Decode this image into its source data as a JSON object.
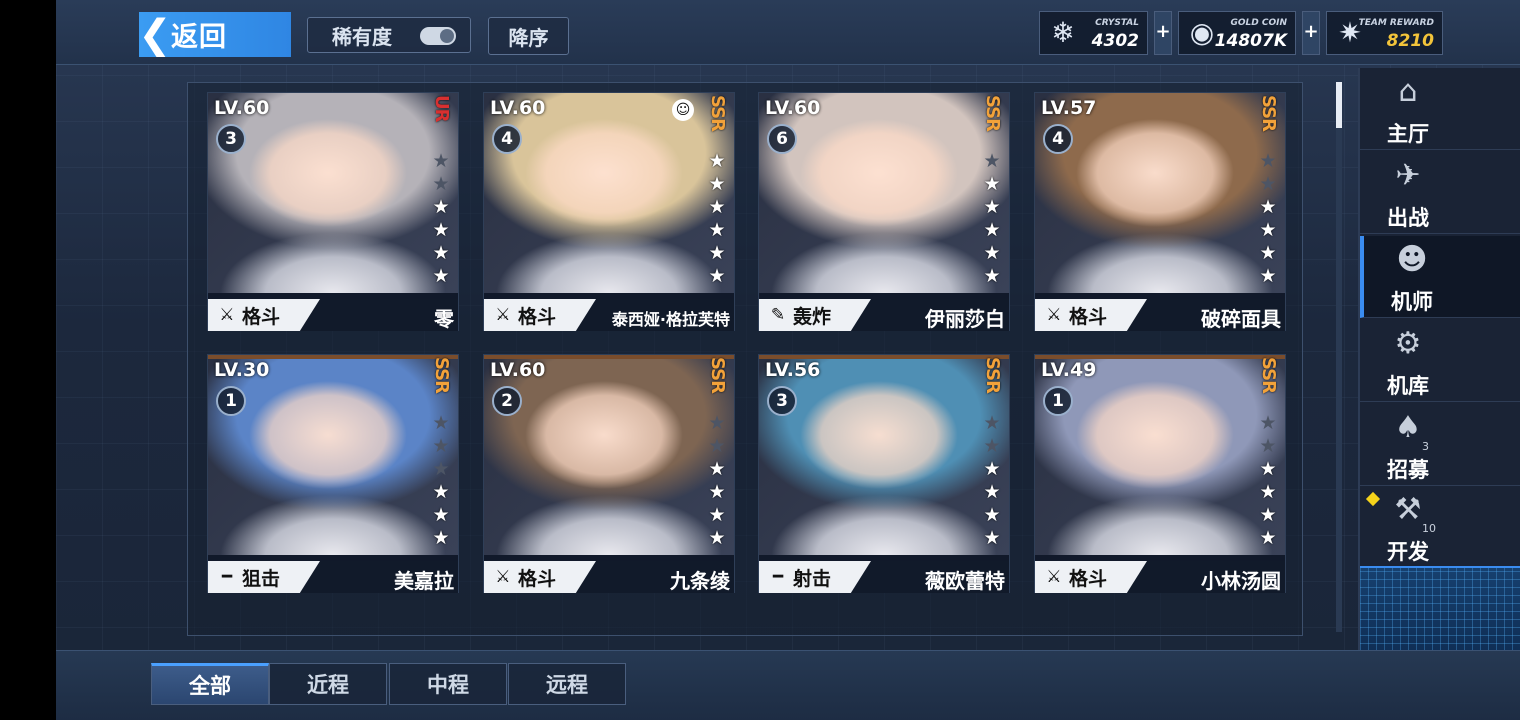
{
  "header": {
    "back_label": "返回",
    "rarity_label": "稀有度",
    "order_label": "降序"
  },
  "currencies": [
    {
      "label": "CRYSTAL",
      "value": "4302",
      "icon": "crystal-icon"
    },
    {
      "label": "GOLD COIN",
      "value": "14807K",
      "icon": "gold-coin-icon"
    },
    {
      "label": "TEAM REWARD",
      "value": "8210",
      "icon": "team-reward-icon"
    }
  ],
  "cards": [
    {
      "level": "LV.60",
      "badge": "3",
      "rank": "UR",
      "stars_on": 4,
      "stars_total": 6,
      "role": "格斗",
      "role_icon": "crossed-swords-icon",
      "name": "零",
      "portrait_color": "#b5b2b8"
    },
    {
      "level": "LV.60",
      "badge": "4",
      "rank": "SSR",
      "stars_on": 6,
      "stars_total": 6,
      "role": "格斗",
      "role_icon": "crossed-swords-icon",
      "name": "泰西娅·格拉芙特",
      "portrait_color": "#d9c49a"
    },
    {
      "level": "LV.60",
      "badge": "6",
      "rank": "SSR",
      "stars_on": 5,
      "stars_total": 6,
      "role": "轰炸",
      "role_icon": "bomb-launcher-icon",
      "name": "伊丽莎白",
      "portrait_color": "#d2c4be"
    },
    {
      "level": "LV.57",
      "badge": "4",
      "rank": "SSR",
      "stars_on": 4,
      "stars_total": 6,
      "role": "格斗",
      "role_icon": "crossed-swords-icon",
      "name": "破碎面具",
      "portrait_color": "#8e6a4c"
    },
    {
      "level": "LV.30",
      "badge": "1",
      "rank": "SSR",
      "stars_on": 3,
      "stars_total": 6,
      "role": "狙击",
      "role_icon": "sniper-rifle-icon",
      "name": "美嘉拉",
      "portrait_color": "#5b84c7"
    },
    {
      "level": "LV.60",
      "badge": "2",
      "rank": "SSR",
      "stars_on": 4,
      "stars_total": 6,
      "role": "格斗",
      "role_icon": "crossed-swords-icon",
      "name": "九条绫",
      "portrait_color": "#7e6552"
    },
    {
      "level": "LV.56",
      "badge": "3",
      "rank": "SSR",
      "stars_on": 4,
      "stars_total": 6,
      "role": "射击",
      "role_icon": "rifle-icon",
      "name": "薇欧蕾特",
      "portrait_color": "#4f8fb4"
    },
    {
      "level": "LV.49",
      "badge": "1",
      "rank": "SSR",
      "stars_on": 4,
      "stars_total": 6,
      "role": "格斗",
      "role_icon": "crossed-swords-icon",
      "name": "小林汤圆",
      "portrait_color": "#8f98b8"
    }
  ],
  "nav": [
    {
      "label": "主厅",
      "icon": "hall-icon",
      "active": false
    },
    {
      "label": "出战",
      "icon": "sortie-icon",
      "active": false
    },
    {
      "label": "机师",
      "icon": "pilot-icon",
      "active": true
    },
    {
      "label": "机库",
      "icon": "hangar-icon",
      "active": false
    },
    {
      "label": "招募",
      "icon": "recruit-card-icon",
      "active": false,
      "count": "3"
    },
    {
      "label": "开发",
      "icon": "develop-gear-icon",
      "active": false,
      "count": "10",
      "notice": true
    }
  ],
  "tabs": [
    {
      "label": "全部",
      "active": true
    },
    {
      "label": "近程",
      "active": false
    },
    {
      "label": "中程",
      "active": false
    },
    {
      "label": "远程",
      "active": false
    }
  ],
  "colors": {
    "accent": "#3a8cf0",
    "ssr": "#f2a23a",
    "ur": "#d83030",
    "notice": "#f5d31b"
  }
}
